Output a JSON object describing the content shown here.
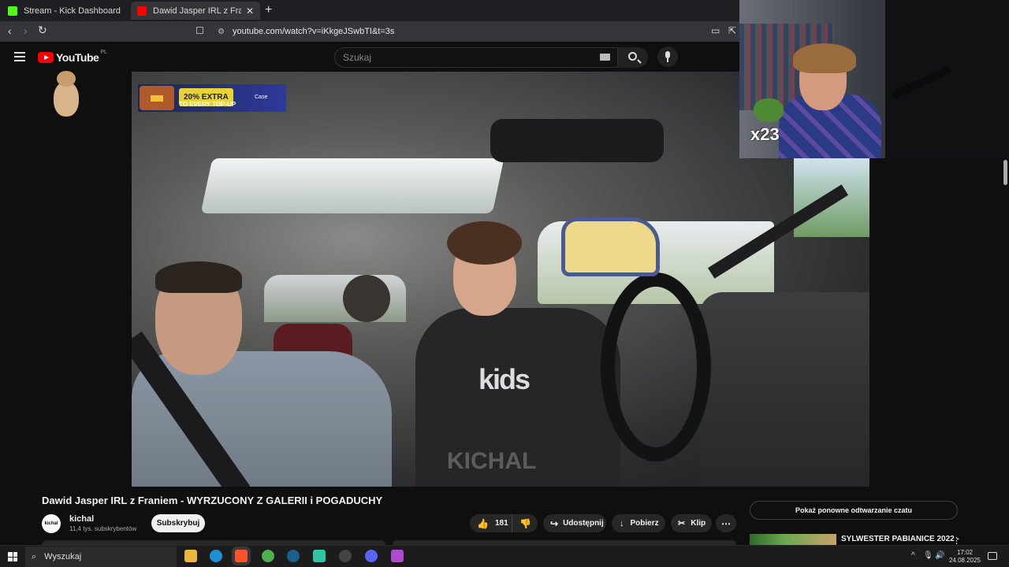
{
  "browser": {
    "tabs": [
      {
        "label": "Stream - Kick Dashboard",
        "favicon_color": "#53fc18"
      },
      {
        "label": "Dawid Jasper IRL z Franiem -",
        "favicon_color": "#ff0000"
      }
    ],
    "close_glyph": "✕",
    "new_tab_glyph": "+",
    "back_glyph": "‹",
    "forward_glyph": "›",
    "reload_glyph": "↻",
    "bookmark_glyph": "☐",
    "tune_glyph": "⚙",
    "url": "youtube.com/watch?v=iKkgeJSwbTI&t=3s",
    "install_glyph": "▭",
    "share_glyph": "⇱"
  },
  "youtube": {
    "logo_text": "YouTube",
    "region": "PL",
    "search_placeholder": "Szukaj"
  },
  "video": {
    "ad": {
      "badge": "20% EXTRA",
      "line": "TO EVERY TOP-UP",
      "brand": "Case"
    },
    "watermark": "KICHAL",
    "shirt_print": "kids"
  },
  "webcam": {
    "count": "x23"
  },
  "below": {
    "title": "Dawid Jasper IRL z Franiem - WYRZUCONY Z GALERII i POGADUCHY",
    "channel_avatar": "kichal",
    "channel": "kichal",
    "subscribers": "11,4 tys. subskrybentów",
    "subscribe": "Subskrybuj",
    "likes": "181",
    "like_glyph": "👍",
    "dislike_glyph": "👎",
    "share": "Udostępnij",
    "share_glyph": "↪",
    "download": "Pobierz",
    "download_glyph": "↓",
    "clip": "Klip",
    "clip_glyph": "✂",
    "more_glyph": "⋯",
    "chat_replay": "Pokaż ponowne odtwarzanie czatu",
    "recommended_title": "SYLWESTER PABIANICE 2022 -",
    "rec_more_glyph": "⋮"
  },
  "taskbar": {
    "search_label": "Wyszukaj",
    "search_glyph": "⌕",
    "apps": [
      {
        "name": "file-explorer",
        "color": "#e8b93b"
      },
      {
        "name": "edge",
        "color": "#1f8fd6"
      },
      {
        "name": "brave",
        "color": "#fb542b"
      },
      {
        "name": "chrome",
        "color": "#4caf50"
      },
      {
        "name": "steam",
        "color": "#1b5f8c"
      },
      {
        "name": "streamlabs",
        "color": "#31c3a2"
      },
      {
        "name": "obs",
        "color": "#444444"
      },
      {
        "name": "discord",
        "color": "#5865f2"
      },
      {
        "name": "other-app",
        "color": "#b04ad0"
      }
    ],
    "tray_up_glyph": "^",
    "tray_mic_glyph": "🎙",
    "tray_volume_glyph": "🔊",
    "time": "17:02",
    "date": "24.08.2025"
  }
}
